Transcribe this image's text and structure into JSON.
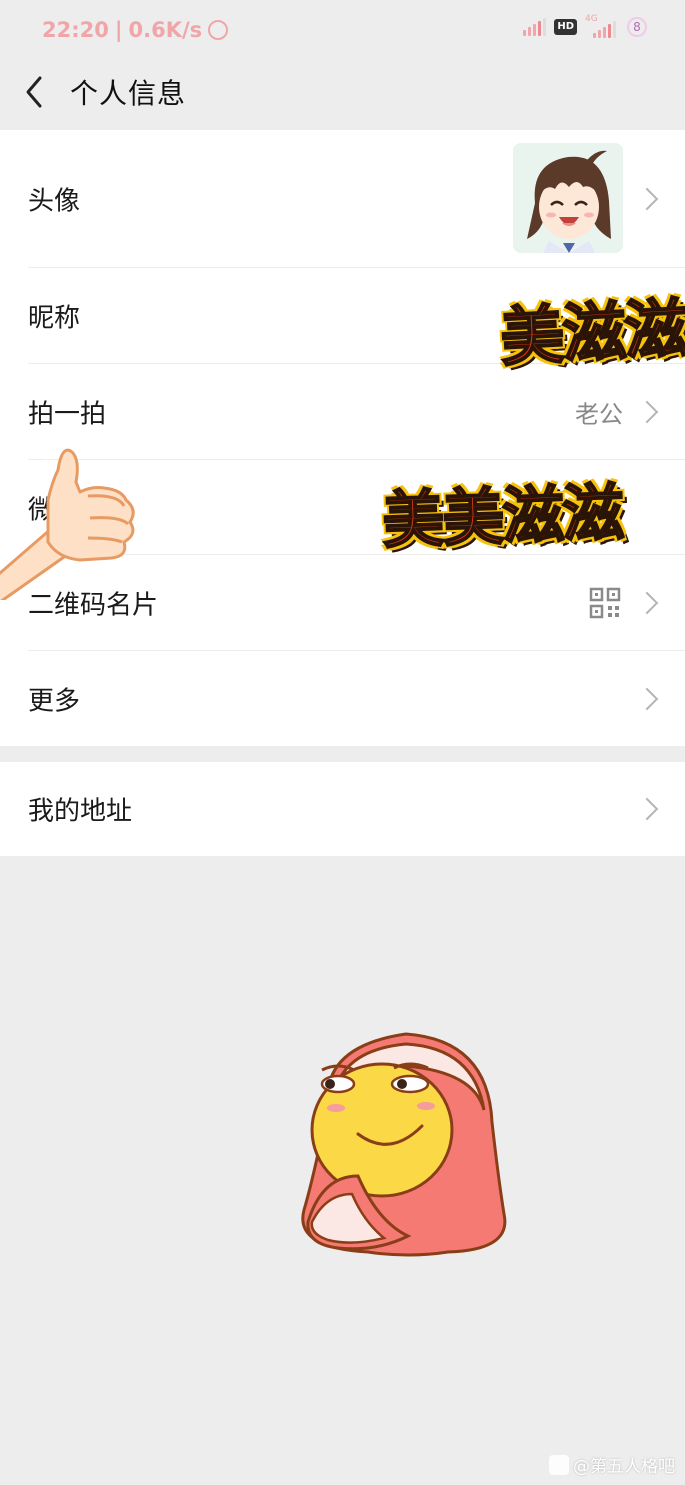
{
  "status_bar": {
    "time": "22:20",
    "speed": "0.6K/s",
    "hd": "HD",
    "network": "4G",
    "battery": "8"
  },
  "nav": {
    "title": "个人信息"
  },
  "rows": {
    "avatar": "头像",
    "nickname": "昵称",
    "pat": "拍一拍",
    "pat_value": "老公",
    "wechat_id": "微",
    "qr_card": "二维码名片",
    "more": "更多"
  },
  "address_group": {
    "my_address": "我的地址"
  },
  "stickers": {
    "nickname_sticker": "美滋滋",
    "wechat_sticker": "美美滋滋"
  },
  "watermark": {
    "text": "@第五人格吧"
  },
  "colors": {
    "background": "#ededed",
    "card": "#ffffff",
    "chevron": "#b5b5b5",
    "status_text": "#f0a5a8"
  },
  "icons": [
    "back-arrow-icon",
    "chevron-right-icon",
    "qr-code-icon",
    "alarm-icon",
    "signal-icon",
    "battery-icon",
    "weibo-logo-icon"
  ]
}
